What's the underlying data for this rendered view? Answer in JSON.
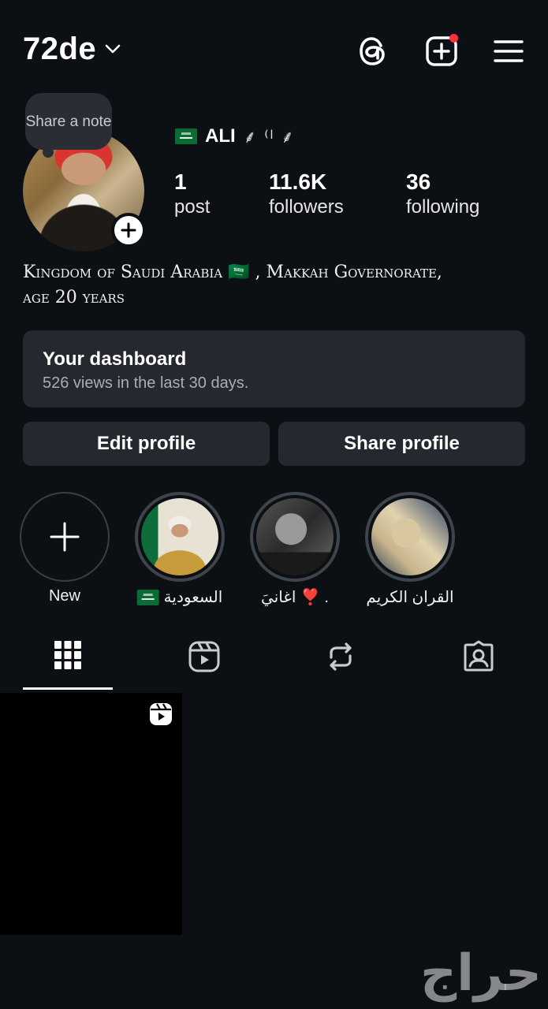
{
  "header": {
    "username": "72de",
    "icons": [
      "chevron-down-icon",
      "threads-icon",
      "create-post-icon",
      "menu-icon"
    ]
  },
  "note": {
    "placeholder": "Share a note"
  },
  "profile": {
    "display_name": "ALI",
    "display_decoration": "⸙ ⁽ˡ ⸙",
    "stats": {
      "posts": {
        "count": "1",
        "label": "post"
      },
      "followers": {
        "count": "11.6K",
        "label": "followers"
      },
      "following": {
        "count": "36",
        "label": "following"
      }
    },
    "bio_line1": "Kingdom of Saudi Arabia 🇸🇦 , Makkah Governorate,",
    "bio_line2": "age 20 years"
  },
  "dashboard": {
    "title": "Your dashboard",
    "subtitle": "526 views in the last 30 days."
  },
  "buttons": {
    "edit": "Edit profile",
    "share": "Share profile"
  },
  "highlights": [
    {
      "label": "New"
    },
    {
      "label": "السعودية"
    },
    {
      "label": "اغانيَ ❣️ ."
    },
    {
      "label": "القران الكريم"
    }
  ],
  "tabs": [
    "grid-icon",
    "reels-icon",
    "reposts-icon",
    "tagged-icon"
  ],
  "watermark": "حراج",
  "colors": {
    "background": "#0c0f14",
    "surface": "#25292f",
    "notification": "#ff3040",
    "flag_green": "#0b6b34"
  }
}
